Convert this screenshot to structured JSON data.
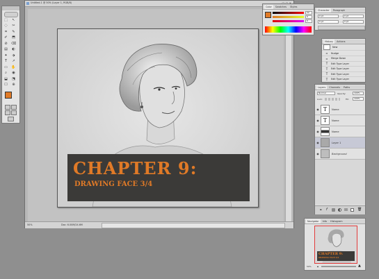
{
  "document": {
    "title": "Untitled-1 @ 50% (Layer 1, RGB/8)",
    "zoom": "50%",
    "doc_info": "Doc: 6.00M/24.6M",
    "banner_title": "CHAPTER 9:",
    "banner_subtitle": "DRAWING FACE 3/4"
  },
  "colors": {
    "accent_orange": "#e07a27",
    "banner_bg": "#3b3a38",
    "workspace_bg": "#8f8f8f"
  },
  "color_panel": {
    "tabs": [
      "Color",
      "Swatches",
      "Styles"
    ],
    "r_value": "22",
    "g_value": "0",
    "b_value": "0"
  },
  "character_panel": {
    "tabs": [
      "Character",
      "Paragraph"
    ],
    "field1": "0 pt",
    "field2": "0 pt",
    "field3": "0 pt",
    "field4": "0 pt"
  },
  "history_panel": {
    "tabs": [
      "History",
      "Actions"
    ],
    "snapshot": "New",
    "items": [
      "Nudge",
      "Merge Down",
      "Edit Type Layer",
      "Edit Type Layer",
      "Edit Type Layer",
      "Edit Type Layer"
    ]
  },
  "layers_panel": {
    "tabs": [
      "Layers",
      "Channels",
      "Paths"
    ],
    "blend_mode": "Normal",
    "opacity_label": "Opacity:",
    "opacity_value": "100%",
    "lock_label": "Lock:",
    "fill_label": "Fill:",
    "fill_value": "100%",
    "layers": [
      {
        "name": "Name",
        "thumb": "T"
      },
      {
        "name": "Name",
        "thumb": "T"
      },
      {
        "name": "Name",
        "thumb": ""
      },
      {
        "name": "Layer 1",
        "thumb": ""
      },
      {
        "name": "Background",
        "thumb": ""
      }
    ]
  },
  "navigator_panel": {
    "tabs": [
      "Navigator",
      "Info",
      "Histogram"
    ],
    "zoom": "50%",
    "thumb_title": "CHAPTER 9:",
    "thumb_subtitle": "DRAWING FACE 3/4"
  }
}
